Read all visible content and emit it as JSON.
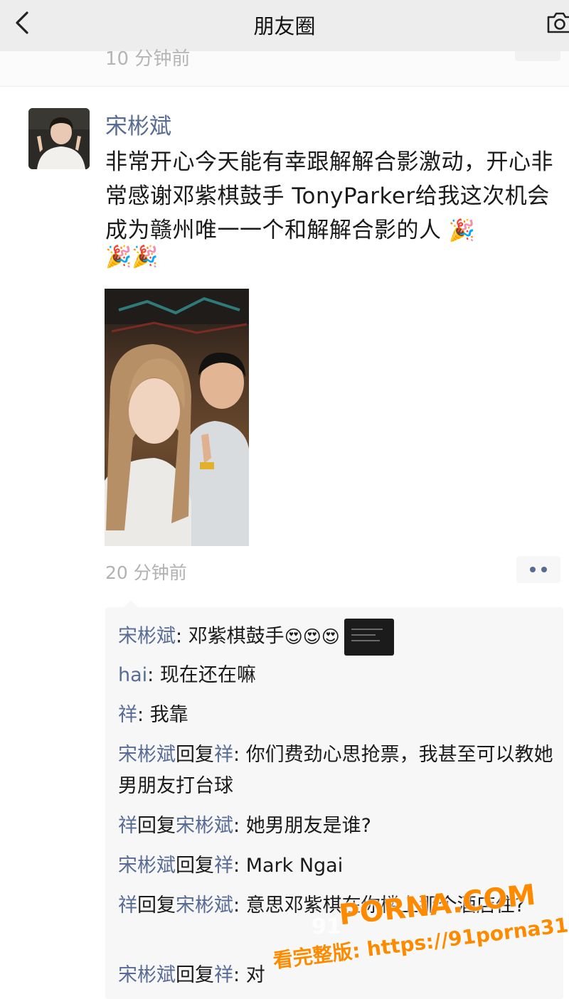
{
  "nav": {
    "title": "朋友圈"
  },
  "previous_post": {
    "time_partial": "10 分钟前"
  },
  "post": {
    "author": "宋彬斌",
    "text": "非常开心今天能有幸跟解解合影激动，开心非常感谢邓紫棋鼓手 TonyParker给我这次机会成为赣州唯一一个和解解合影的人",
    "text_trailing_emoji": "🎉",
    "emoji_line": "🎉🎉",
    "time": "20 分钟前"
  },
  "comments": [
    {
      "from": "宋彬斌",
      "reply_word": "",
      "to": "",
      "sep": ": ",
      "text": "邓紫棋鼓手",
      "emojis": "😍😍😍",
      "has_thumbnail": true
    },
    {
      "from": "hai",
      "reply_word": "",
      "to": "",
      "sep": ": ",
      "text": "现在还在嘛"
    },
    {
      "from": "祥",
      "reply_word": "",
      "to": "",
      "sep": ": ",
      "text": "我靠"
    },
    {
      "from": "宋彬斌",
      "reply_word": "回复",
      "to": "祥",
      "sep": ": ",
      "text": "你们费劲心思抢票，我甚至可以教她男朋友打台球"
    },
    {
      "from": "祥",
      "reply_word": "回复",
      "to": "宋彬斌",
      "sep": ": ",
      "text": "她男朋友是谁?"
    },
    {
      "from": "宋彬斌",
      "reply_word": "回复",
      "to": "祥",
      "sep": ": ",
      "text": "Mark Ngai"
    },
    {
      "from": "祥",
      "reply_word": "回复",
      "to": "宋彬斌",
      "sep": ": ",
      "text": "意思邓紫棋在你楼上那个酒店住?"
    },
    {
      "from": "宋彬斌",
      "reply_word": "回复",
      "to": "祥",
      "sep": ": ",
      "text": "对"
    }
  ],
  "watermark": {
    "brand": "PORNA.COM",
    "ghost": "91",
    "line": "看完整版: https://91porna31.com"
  },
  "colors": {
    "name_link": "#576b95",
    "nav_bg": "#ededed",
    "comment_bg": "#f7f7f7",
    "watermark": "#ff8a00"
  }
}
